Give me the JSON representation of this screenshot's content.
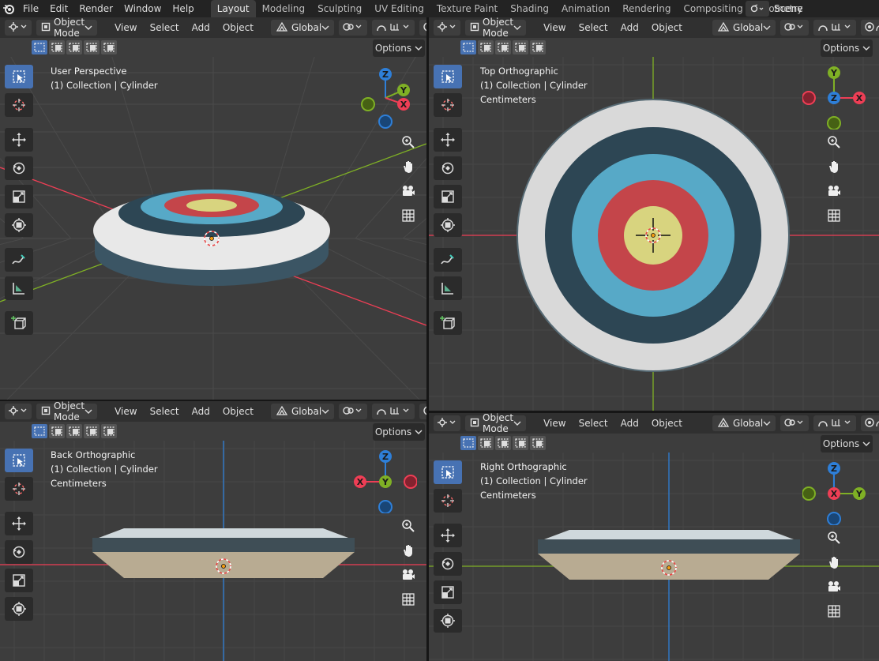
{
  "menu": {
    "file": "File",
    "edit": "Edit",
    "render": "Render",
    "window": "Window",
    "help": "Help"
  },
  "workspaces": [
    "Layout",
    "Modeling",
    "Sculpting",
    "UV Editing",
    "Texture Paint",
    "Shading",
    "Animation",
    "Rendering",
    "Compositing",
    "Geometry"
  ],
  "active_workspace": "Layout",
  "scene": "Scene",
  "header": {
    "mode": "Object Mode",
    "view": "View",
    "select": "Select",
    "add": "Add",
    "object": "Object",
    "orientation": "Global",
    "options": "Options"
  },
  "viewports": {
    "tl": {
      "view": "User Perspective",
      "collection": "(1) Collection | Cylinder",
      "units": ""
    },
    "tr": {
      "view": "Top Orthographic",
      "collection": "(1) Collection | Cylinder",
      "units": "Centimeters"
    },
    "bl": {
      "view": "Back Orthographic",
      "collection": "(1) Collection | Cylinder",
      "units": "Centimeters"
    },
    "br": {
      "view": "Right Orthographic",
      "collection": "(1) Collection | Cylinder",
      "units": "Centimeters"
    }
  },
  "axes": {
    "x": "X",
    "y": "Y",
    "z": "Z"
  },
  "colors": {
    "axis_x": "#ee3e55",
    "axis_y": "#7fb025",
    "axis_z": "#2e7fd8",
    "target_white": "#e8e8e8",
    "target_dark": "#2d4654",
    "target_blue": "#57a9c7",
    "target_red": "#c4454a",
    "target_yellow": "#d8d47f",
    "accent": "#4772b3"
  }
}
